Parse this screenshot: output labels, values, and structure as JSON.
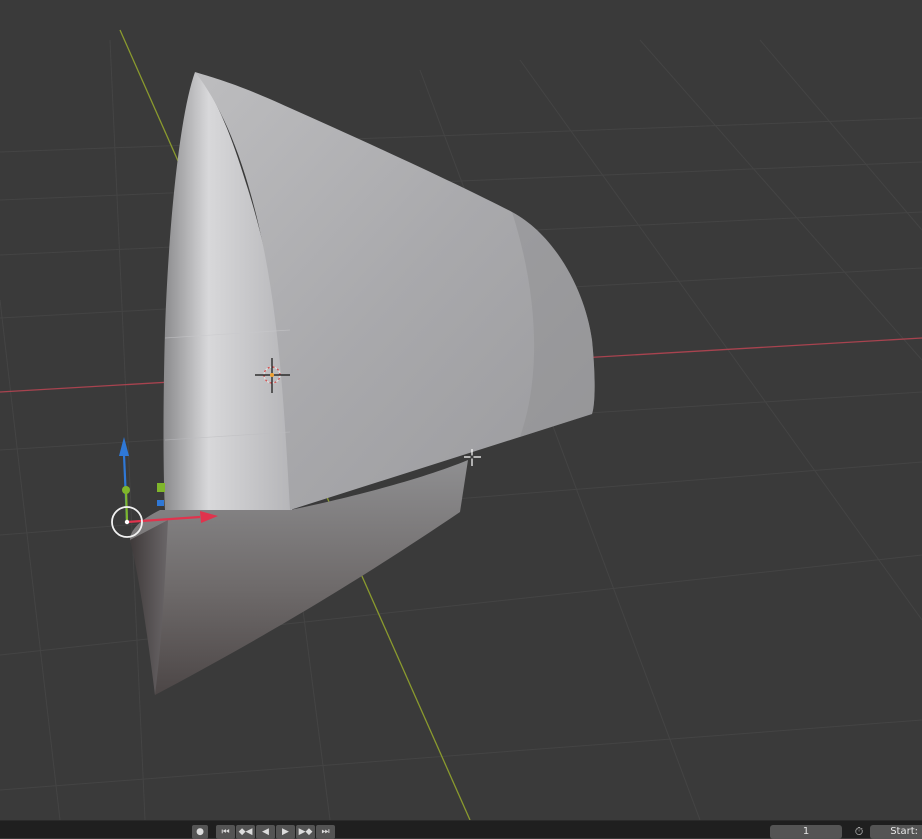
{
  "viewport": {
    "background": "#3a3a3a",
    "grid_color": "#444444",
    "x_axis_color": "#a8434f",
    "y_axis_color": "#8a9a2e",
    "object": "curved-surface-mesh",
    "gizmo_colors": {
      "z": "#2f78d6",
      "y": "#7fb62b",
      "x": "#e0334d"
    }
  },
  "timeline": {
    "record_icon": "●",
    "controls": [
      {
        "name": "jump-to-start-icon",
        "glyph": "⏮"
      },
      {
        "name": "prev-keyframe-icon",
        "glyph": "◆◀"
      },
      {
        "name": "play-reverse-icon",
        "glyph": "◀"
      },
      {
        "name": "play-icon",
        "glyph": "▶"
      },
      {
        "name": "next-keyframe-icon",
        "glyph": "▶◆"
      },
      {
        "name": "jump-to-end-icon",
        "glyph": "⏭"
      }
    ],
    "current_frame": "1",
    "clock_icon": "⏱",
    "start_label": "Start:"
  }
}
